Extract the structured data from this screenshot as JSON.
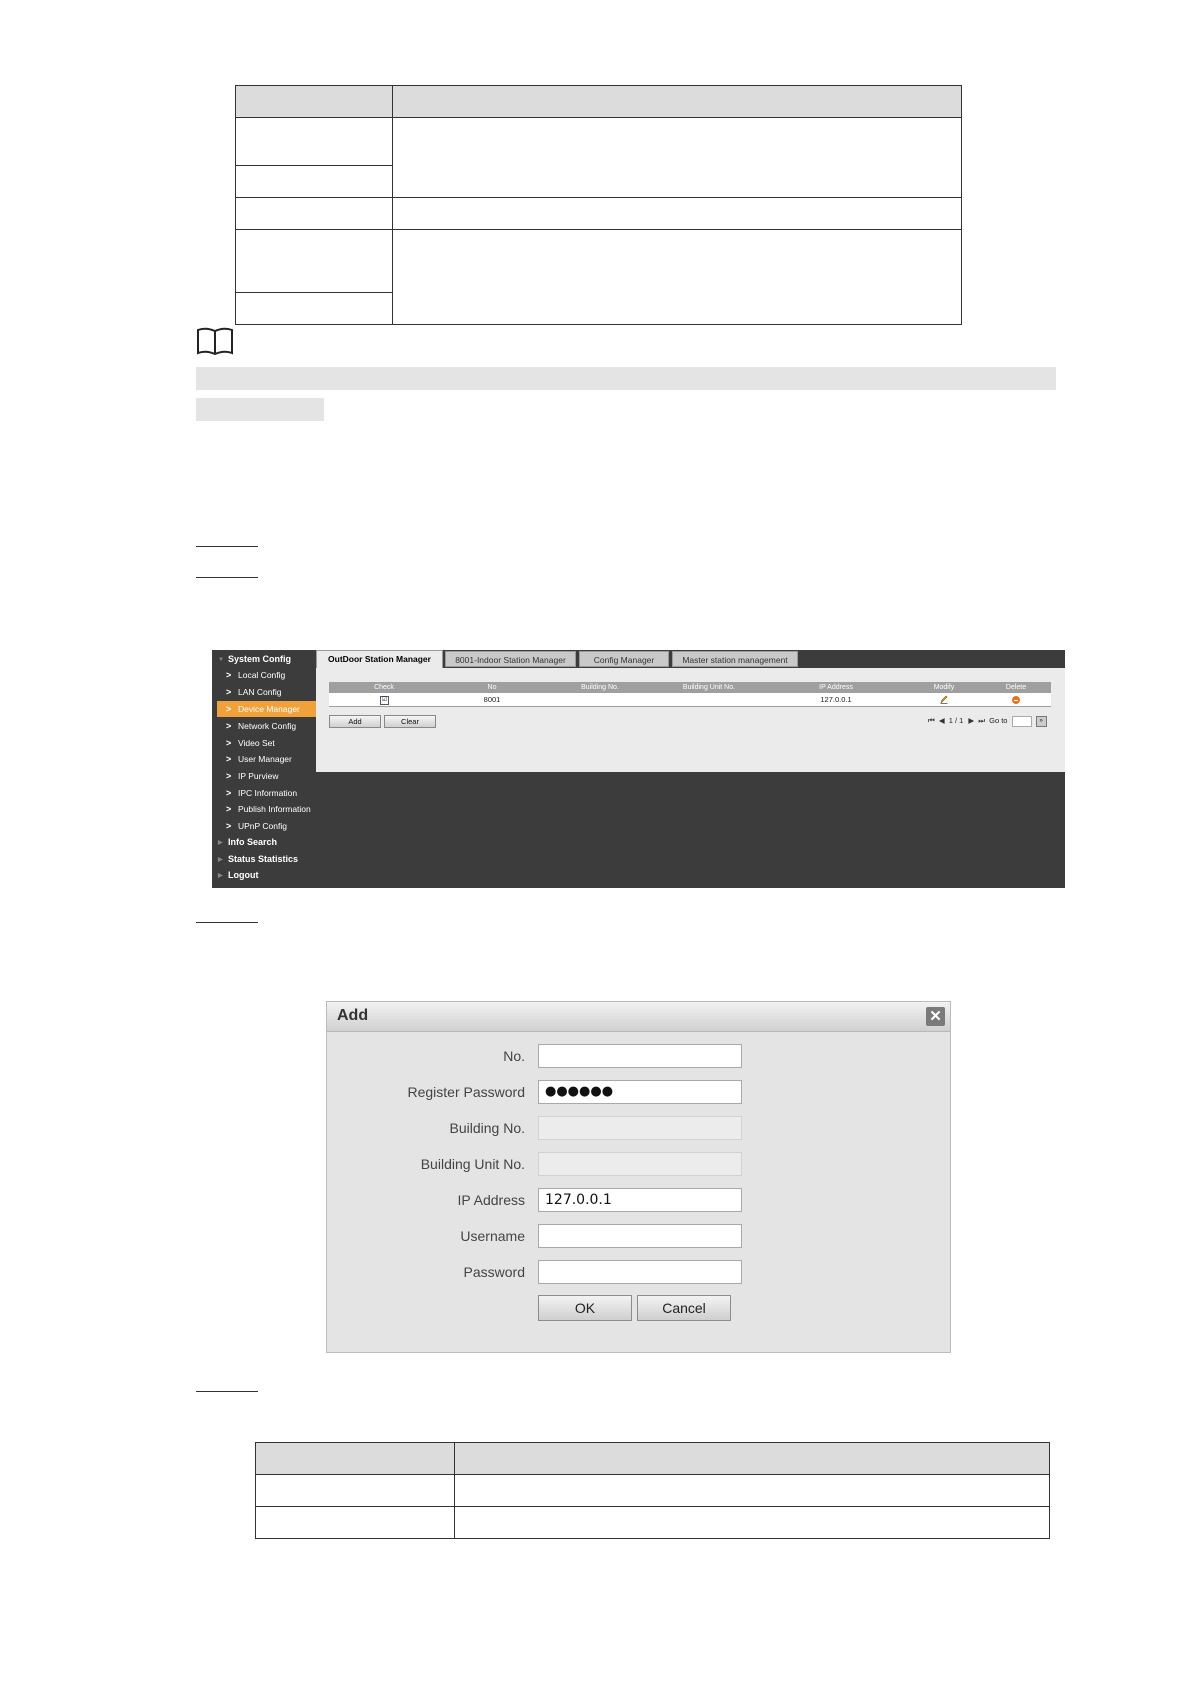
{
  "device_manager": {
    "sidebar": [
      {
        "label": "System Config",
        "level": "top",
        "expanded": true
      },
      {
        "label": "Local Config",
        "level": "sub"
      },
      {
        "label": "LAN Config",
        "level": "sub"
      },
      {
        "label": "Device Manager",
        "level": "sub",
        "active": true
      },
      {
        "label": "Network Config",
        "level": "sub"
      },
      {
        "label": "Video Set",
        "level": "sub"
      },
      {
        "label": "User Manager",
        "level": "sub"
      },
      {
        "label": "IP Purview",
        "level": "sub"
      },
      {
        "label": "IPC Information",
        "level": "sub"
      },
      {
        "label": "Publish Information",
        "level": "sub"
      },
      {
        "label": "UPnP Config",
        "level": "sub"
      },
      {
        "label": "Info Search",
        "level": "top"
      },
      {
        "label": "Status Statistics",
        "level": "top"
      },
      {
        "label": "Logout",
        "level": "top"
      }
    ],
    "tabs": [
      {
        "label": "OutDoor Station Manager",
        "active": true
      },
      {
        "label": "8001-Indoor Station Manager"
      },
      {
        "label": "Config Manager"
      },
      {
        "label": "Master station management"
      }
    ],
    "table": {
      "headers": [
        "Check",
        "No",
        "Building No.",
        "Building Unit No.",
        "IP Address",
        "Modify",
        "Delete"
      ],
      "rows": [
        {
          "check": "☑",
          "no": "8001",
          "building_no": "",
          "building_unit_no": "",
          "ip": "127.0.0.1"
        }
      ]
    },
    "buttons": {
      "add": "Add",
      "clear": "Clear"
    },
    "pager": {
      "page_info": "1 / 1",
      "goto_label": "Go to"
    },
    "colors": {
      "active_item": "#f1a13a",
      "sidebar_bg": "#3c3c3c",
      "delete_icon": "#e8731b"
    }
  },
  "add_dialog": {
    "title": "Add",
    "fields": [
      {
        "label": "No.",
        "value": "",
        "disabled": false
      },
      {
        "label": "Register Password",
        "value": "●●●●●●",
        "disabled": false
      },
      {
        "label": "Building No.",
        "value": "",
        "disabled": true
      },
      {
        "label": "Building Unit No.",
        "value": "",
        "disabled": true
      },
      {
        "label": "IP Address",
        "value": "127.0.0.1",
        "disabled": false
      },
      {
        "label": "Username",
        "value": "",
        "disabled": false
      },
      {
        "label": "Password",
        "value": "",
        "disabled": false
      }
    ],
    "ok_label": "OK",
    "cancel_label": "Cancel"
  }
}
